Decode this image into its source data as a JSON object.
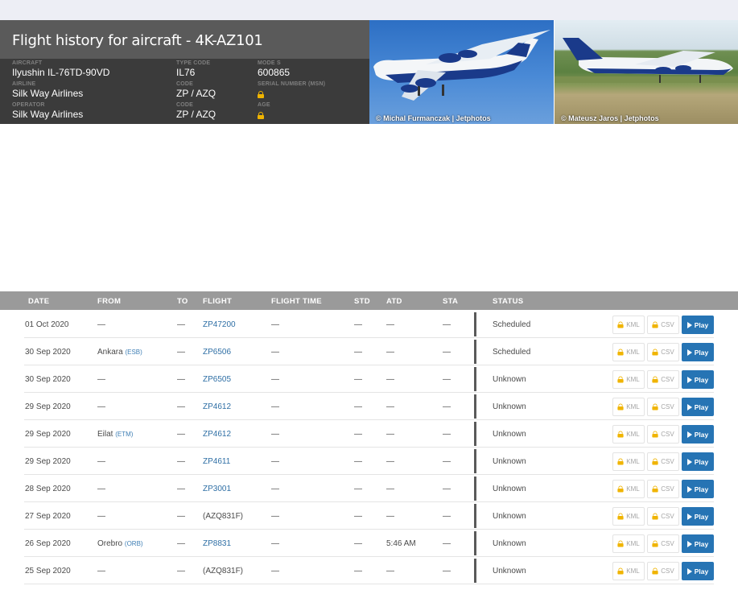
{
  "header": {
    "title": "Flight history for aircraft - 4K-AZ101",
    "fields": {
      "aircraft": {
        "label": "AIRCRAFT",
        "value": "Ilyushin IL-76TD-90VD"
      },
      "type_code": {
        "label": "TYPE CODE",
        "value": "IL76"
      },
      "mode_s": {
        "label": "MODE S",
        "value": "600865"
      },
      "airline": {
        "label": "AIRLINE",
        "value": "Silk Way Airlines"
      },
      "airline_code": {
        "label": "Code",
        "value": "ZP / AZQ"
      },
      "serial": {
        "label": "SERIAL NUMBER (MSN)"
      },
      "operator": {
        "label": "OPERATOR",
        "value": "Silk Way Airlines"
      },
      "operator_code": {
        "label": "Code",
        "value": "ZP / AZQ"
      },
      "age": {
        "label": "AGE"
      }
    }
  },
  "photos": [
    {
      "credit": "© Michal Furmanczak | Jetphotos"
    },
    {
      "credit": "© Mateusz Jaros | Jetphotos"
    }
  ],
  "table": {
    "columns": [
      "DATE",
      "FROM",
      "TO",
      "FLIGHT",
      "FLIGHT TIME",
      "STD",
      "ATD",
      "STA",
      "STATUS"
    ],
    "buttons": {
      "kml": "KML",
      "csv": "CSV",
      "play": "Play"
    },
    "rows": [
      {
        "date": "01 Oct 2020",
        "from": "—",
        "from_code": "",
        "to": "—",
        "flight": "ZP47200",
        "flight_time": "—",
        "std": "—",
        "atd": "—",
        "sta": "—",
        "status": "Scheduled"
      },
      {
        "date": "30 Sep 2020",
        "from": "Ankara",
        "from_code": "(ESB)",
        "to": "—",
        "flight": "ZP6506",
        "flight_time": "—",
        "std": "—",
        "atd": "—",
        "sta": "—",
        "status": "Scheduled"
      },
      {
        "date": "30 Sep 2020",
        "from": "—",
        "from_code": "",
        "to": "—",
        "flight": "ZP6505",
        "flight_time": "—",
        "std": "—",
        "atd": "—",
        "sta": "—",
        "status": "Unknown"
      },
      {
        "date": "29 Sep 2020",
        "from": "—",
        "from_code": "",
        "to": "—",
        "flight": "ZP4612",
        "flight_time": "—",
        "std": "—",
        "atd": "—",
        "sta": "—",
        "status": "Unknown"
      },
      {
        "date": "29 Sep 2020",
        "from": "Eilat",
        "from_code": "(ETM)",
        "to": "—",
        "flight": "ZP4612",
        "flight_time": "—",
        "std": "—",
        "atd": "—",
        "sta": "—",
        "status": "Unknown"
      },
      {
        "date": "29 Sep 2020",
        "from": "—",
        "from_code": "",
        "to": "—",
        "flight": "ZP4611",
        "flight_time": "—",
        "std": "—",
        "atd": "—",
        "sta": "—",
        "status": "Unknown"
      },
      {
        "date": "28 Sep 2020",
        "from": "—",
        "from_code": "",
        "to": "—",
        "flight": "ZP3001",
        "flight_time": "—",
        "std": "—",
        "atd": "—",
        "sta": "—",
        "status": "Unknown"
      },
      {
        "date": "27 Sep 2020",
        "from": "—",
        "from_code": "",
        "to": "—",
        "flight": "(AZQ831F)",
        "flight_time": "—",
        "std": "—",
        "atd": "—",
        "sta": "—",
        "status": "Unknown"
      },
      {
        "date": "26 Sep 2020",
        "from": "Orebro",
        "from_code": "(ORB)",
        "to": "—",
        "flight": "ZP8831",
        "flight_time": "—",
        "std": "—",
        "atd": "5:46 AM",
        "sta": "—",
        "status": "Unknown"
      },
      {
        "date": "25 Sep 2020",
        "from": "—",
        "from_code": "",
        "to": "—",
        "flight": "(AZQ831F)",
        "flight_time": "—",
        "std": "—",
        "atd": "—",
        "sta": "—",
        "status": "Unknown"
      }
    ]
  }
}
